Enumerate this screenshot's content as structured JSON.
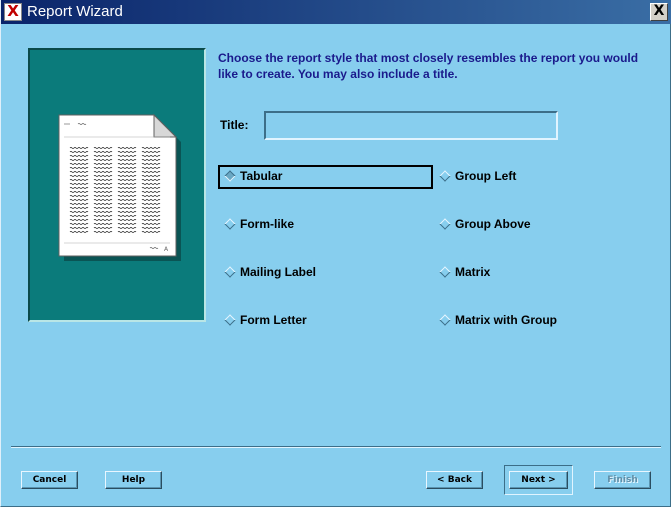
{
  "window": {
    "title": "Report Wizard",
    "app_icon": "x-app-icon",
    "close_glyph": "X"
  },
  "instructions": "Choose the report style that most closely resembles the report you would like to create. You may also include a title.",
  "title_field": {
    "label": "Title:",
    "value": ""
  },
  "styles": {
    "selected": "Tabular",
    "options": [
      {
        "label": "Tabular"
      },
      {
        "label": "Form-like"
      },
      {
        "label": "Mailing Label"
      },
      {
        "label": "Form Letter"
      },
      {
        "label": "Group Left"
      },
      {
        "label": "Group Above"
      },
      {
        "label": "Matrix"
      },
      {
        "label": "Matrix with Group"
      }
    ]
  },
  "buttons": {
    "cancel": "Cancel",
    "help": "Help",
    "back": "< Back",
    "next": "Next >",
    "finish": "Finish"
  },
  "colors": {
    "background": "#87ceee",
    "preview_panel": "#0b7b7b",
    "instruction_text": "#1a1a8c",
    "titlebar": "#0a246a"
  }
}
